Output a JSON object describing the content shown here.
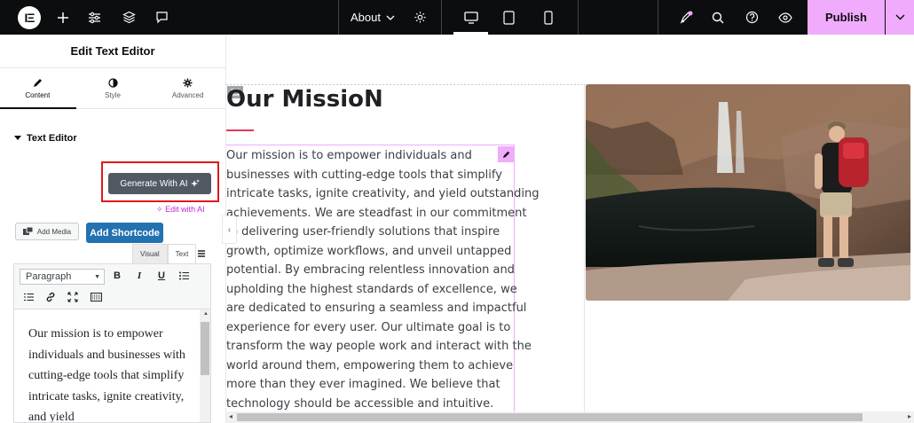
{
  "topbar": {
    "page_name": "About",
    "publish_label": "Publish",
    "colors": {
      "bar": "#0c0d0e",
      "publish": "#f0abfc"
    }
  },
  "panel": {
    "title": "Edit Text Editor",
    "tabs": [
      {
        "label": "Content",
        "icon": "pencil-icon"
      },
      {
        "label": "Style",
        "icon": "contrast-icon"
      },
      {
        "label": "Advanced",
        "icon": "gear-icon"
      }
    ],
    "section_title": "Text Editor",
    "ai_button": "Generate With AI",
    "edit_with_ai": "Edit with AI",
    "add_media": "Add Media",
    "add_shortcode": "Add Shortcode",
    "editor_tabs": [
      "Visual",
      "Text"
    ],
    "format_select": "Paragraph",
    "editor_text": "Our mission is to empower individuals and businesses with cutting-edge tools that simplify intricate tasks, ignite creativity, and yield"
  },
  "canvas": {
    "heading": "Our MissioN",
    "body_lines": [
      "Our mission is to empower individuals and",
      "businesses with cutting-edge tools that simplify",
      "intricate tasks, ignite creativity, and yield outstanding",
      "achievements. We are steadfast in our commitment",
      "to delivering user-friendly solutions that inspire",
      "growth, optimize workflows, and unveil untapped",
      "potential. By embracing relentless innovation and",
      "upholding the highest standards of excellence, we",
      "are dedicated to ensuring a seamless and impactful",
      "experience for every user. Our ultimate goal is to",
      "transform the way people work and interact with the",
      "world around them, empowering them to achieve",
      "more than they ever imagined. We believe that",
      "technology should be accessible and intuitive."
    ],
    "accent": "#e2365c"
  }
}
